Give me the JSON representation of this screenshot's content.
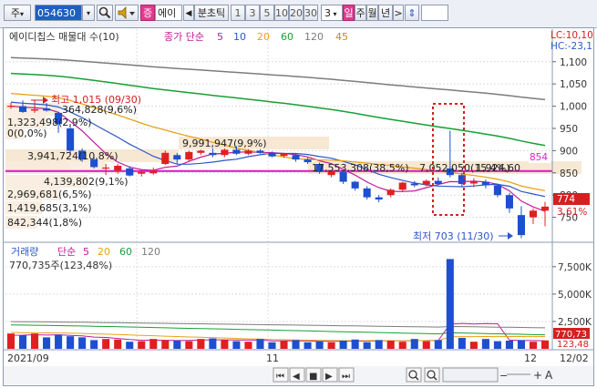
{
  "toolbar": {
    "market_label": "주",
    "code_value": "054630",
    "search_icon": "search-icon",
    "speaker_icon": "speaker-icon",
    "stock_badge": "증",
    "stock_name": "에이",
    "prev_arrow": "◀",
    "period_label": "분초틱",
    "periods": [
      "1",
      "3",
      "5",
      "10",
      "20",
      "30"
    ],
    "period_select_value": "3",
    "daily": "일",
    "weekly": "주",
    "monthly": "월",
    "yearly": "년",
    "next_arrow": ">",
    "updown_icon": "updown-icon"
  },
  "price_panel": {
    "legend_title": "에이디칩스 매물대 수(10)",
    "legend_ma_prefix": "종가 단순",
    "ma_periods": [
      {
        "label": "5",
        "color": "#c01a9a"
      },
      {
        "label": "10",
        "color": "#2b57c9"
      },
      {
        "label": "20",
        "color": "#e8a317"
      },
      {
        "label": "60",
        "color": "#16a035"
      },
      {
        "label": "120",
        "color": "#7c7c7c"
      },
      {
        "label": "45",
        "color": "#d4801c"
      }
    ],
    "corner_lc": "LC:10,10",
    "corner_hc": "HC:-23,1",
    "high_label": "최고 1,015 (09/30)",
    "low_label": "최저 703 (11/30)",
    "hline_label": "854",
    "last_price": "774",
    "last_change": "3.61%",
    "y_ticks": [
      "1,100",
      "1,050",
      "1,000",
      "950",
      "900",
      "850",
      "800",
      "750"
    ],
    "volume_profile_labels": [
      "364,828(9,6%)",
      "1,323,498(2,9%)",
      "0(0,0%)",
      "3,941,724(10,8%)",
      "9,991,947(9,9%)",
      "4,139,802(9,1%)",
      "17,553,308(38,5%)",
      "7,052,050(15,4%)",
      "1,924,60",
      "2,969,681(6,5%)",
      "1,419,685(3,1%)",
      "842,344(1,8%)"
    ],
    "candles": [
      {
        "date": "09/28",
        "open": 1000,
        "high": 1008,
        "low": 994,
        "close": 1001
      },
      {
        "date": "09/29",
        "open": 1000,
        "high": 1013,
        "low": 985,
        "close": 987
      },
      {
        "date": "09/30",
        "open": 990,
        "high": 1015,
        "low": 985,
        "close": 993
      },
      {
        "date": "10/01",
        "open": 995,
        "high": 1007,
        "low": 988,
        "close": 990
      },
      {
        "date": "10/05",
        "open": 985,
        "high": 987,
        "low": 940,
        "close": 960
      },
      {
        "date": "10/06",
        "open": 950,
        "high": 955,
        "low": 890,
        "close": 900
      },
      {
        "date": "10/07",
        "open": 900,
        "high": 905,
        "low": 875,
        "close": 880
      },
      {
        "date": "10/08",
        "open": 880,
        "high": 885,
        "low": 860,
        "close": 863
      },
      {
        "date": "10/12",
        "open": 860,
        "high": 870,
        "low": 845,
        "close": 862
      },
      {
        "date": "10/13",
        "open": 855,
        "high": 870,
        "low": 848,
        "close": 866
      },
      {
        "date": "10/14",
        "open": 860,
        "high": 865,
        "low": 842,
        "close": 844
      },
      {
        "date": "10/15",
        "open": 848,
        "high": 858,
        "low": 842,
        "close": 852
      },
      {
        "date": "10/18",
        "open": 849,
        "high": 862,
        "low": 846,
        "close": 855
      },
      {
        "date": "10/19",
        "open": 870,
        "high": 900,
        "low": 868,
        "close": 895
      },
      {
        "date": "10/20",
        "open": 890,
        "high": 895,
        "low": 870,
        "close": 880
      },
      {
        "date": "10/21",
        "open": 880,
        "high": 900,
        "low": 875,
        "close": 897
      },
      {
        "date": "10/22",
        "open": 895,
        "high": 902,
        "low": 890,
        "close": 900
      },
      {
        "date": "10/25",
        "open": 895,
        "high": 905,
        "low": 885,
        "close": 890
      },
      {
        "date": "10/26",
        "open": 890,
        "high": 905,
        "low": 885,
        "close": 902
      },
      {
        "date": "10/27",
        "open": 902,
        "high": 910,
        "low": 890,
        "close": 893
      },
      {
        "date": "10/28",
        "open": 893,
        "high": 903,
        "low": 890,
        "close": 900
      },
      {
        "date": "10/29",
        "open": 900,
        "high": 903,
        "low": 893,
        "close": 895
      },
      {
        "date": "11/01",
        "open": 895,
        "high": 898,
        "low": 885,
        "close": 887
      },
      {
        "date": "11/02",
        "open": 888,
        "high": 895,
        "low": 884,
        "close": 893
      },
      {
        "date": "11/03",
        "open": 890,
        "high": 893,
        "low": 875,
        "close": 880
      },
      {
        "date": "11/04",
        "open": 880,
        "high": 884,
        "low": 870,
        "close": 874
      },
      {
        "date": "11/05",
        "open": 870,
        "high": 873,
        "low": 848,
        "close": 852
      },
      {
        "date": "11/08",
        "open": 845,
        "high": 856,
        "low": 840,
        "close": 854
      },
      {
        "date": "11/09",
        "open": 852,
        "high": 855,
        "low": 825,
        "close": 830
      },
      {
        "date": "11/10",
        "open": 830,
        "high": 832,
        "low": 810,
        "close": 815
      },
      {
        "date": "11/11",
        "open": 815,
        "high": 820,
        "low": 790,
        "close": 795
      },
      {
        "date": "11/12",
        "open": 795,
        "high": 800,
        "low": 784,
        "close": 790
      },
      {
        "date": "11/15",
        "open": 800,
        "high": 815,
        "low": 795,
        "close": 812
      },
      {
        "date": "11/16",
        "open": 812,
        "high": 830,
        "low": 808,
        "close": 828
      },
      {
        "date": "11/17",
        "open": 826,
        "high": 832,
        "low": 818,
        "close": 822
      },
      {
        "date": "11/18",
        "open": 824,
        "high": 835,
        "low": 820,
        "close": 832
      },
      {
        "date": "11/19",
        "open": 832,
        "high": 840,
        "low": 822,
        "close": 825
      },
      {
        "date": "11/22",
        "open": 860,
        "high": 945,
        "low": 840,
        "close": 845
      },
      {
        "date": "11/23",
        "open": 845,
        "high": 850,
        "low": 820,
        "close": 825
      },
      {
        "date": "11/24",
        "open": 826,
        "high": 838,
        "low": 818,
        "close": 830
      },
      {
        "date": "11/25",
        "open": 830,
        "high": 835,
        "low": 815,
        "close": 822
      },
      {
        "date": "11/26",
        "open": 822,
        "high": 826,
        "low": 795,
        "close": 800
      },
      {
        "date": "11/29",
        "open": 800,
        "high": 805,
        "low": 760,
        "close": 770
      },
      {
        "date": "11/30",
        "open": 755,
        "high": 775,
        "low": 703,
        "close": 710
      },
      {
        "date": "12/01",
        "open": 750,
        "high": 770,
        "low": 735,
        "close": 765
      },
      {
        "date": "12/02",
        "open": 765,
        "high": 785,
        "low": 730,
        "close": 774
      }
    ]
  },
  "volume_panel": {
    "legend_title": "거래량",
    "legend_ma_prefix": "단순",
    "ma_periods": [
      {
        "label": "5",
        "color": "#c01a9a"
      },
      {
        "label": "20",
        "color": "#e8a317"
      },
      {
        "label": "60",
        "color": "#16a035"
      },
      {
        "label": "120",
        "color": "#7c7c7c"
      }
    ],
    "last_volume_label": "770,735주(123,48%)",
    "y_ticks": [
      "7,500K",
      "5,000K",
      "2,500K"
    ],
    "last_value_box": "770,73",
    "last_change_box": "123,48",
    "volumes_k": [
      1400,
      1250,
      1400,
      1050,
      1300,
      1150,
      1050,
      800,
      900,
      850,
      650,
      700,
      900,
      800,
      750,
      700,
      900,
      950,
      800,
      700,
      650,
      900,
      600,
      750,
      800,
      600,
      700,
      600,
      750,
      850,
      600,
      800,
      750,
      650,
      900,
      700,
      800,
      8200,
      1000,
      650,
      900,
      700,
      750,
      800,
      650,
      771
    ]
  },
  "x_axis": {
    "labels": [
      "2021/09",
      "11",
      "12",
      "12/02"
    ]
  },
  "navigator": {
    "buttons": [
      "⏮",
      "◀",
      "■",
      "▶",
      "⏭"
    ],
    "zoom_icons": [
      "zoom-icon",
      "zoom-icon"
    ],
    "minus": "−",
    "plus": "+",
    "font_label": "A"
  }
}
